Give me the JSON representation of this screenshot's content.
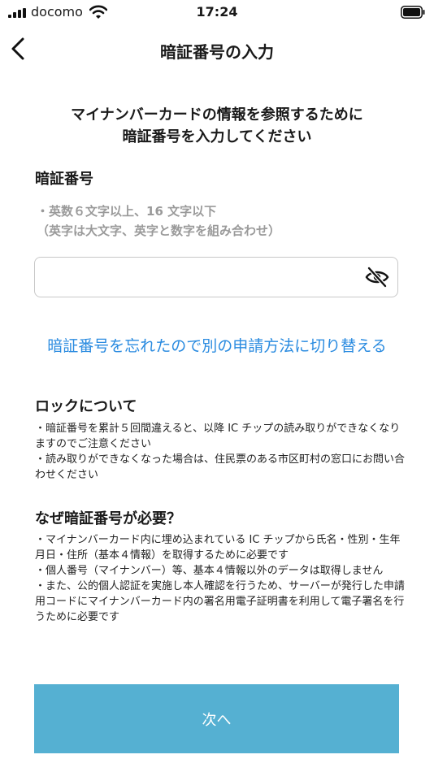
{
  "status_bar": {
    "carrier": "docomo",
    "time": "17:24"
  },
  "nav": {
    "title": "暗証番号の入力"
  },
  "intro": {
    "line1": "マイナンバーカードの情報を参照するために",
    "line2": "暗証番号を入力してください"
  },
  "pin": {
    "heading": "暗証番号",
    "hint_line1": "・英数６文字以上、16 文字以下",
    "hint_line2": "（英字は大文字、英字と数字を組み合わせ）",
    "value": ""
  },
  "switch_link": "暗証番号を忘れたので別の申請方法に切り替える",
  "lock": {
    "heading": "ロックについて",
    "items": [
      "・暗証番号を累計５回間違えると、以降 IC チップの読み取りができなくなりますのでご注意ください",
      "・読み取りができなくなった場合は、住民票のある市区町村の窓口にお問い合わせください"
    ]
  },
  "why": {
    "heading": "なぜ暗証番号が必要？",
    "items": [
      "・マイナンバーカード内に埋め込まれている IC チップから氏名・性別・生年月日・住所（基本４情報）を取得するために必要です",
      "・個人番号（マイナンバー）等、基本４情報以外のデータは取得しません",
      "・また、公的個人認証を実施し本人確認を行うため、サーバーが発行した申請用コードにマイナンバーカード内の署名用電子証明書を利用して電子署名を行うために必要です"
    ]
  },
  "next_button": {
    "label": "次へ"
  },
  "colors": {
    "link": "#2a8be0",
    "button": "#55b0d2"
  },
  "icons": {
    "back": "chevron-left-icon",
    "eye": "eye-slash-icon",
    "signal": "signal-icon",
    "wifi": "wifi-icon",
    "battery": "battery-icon"
  }
}
